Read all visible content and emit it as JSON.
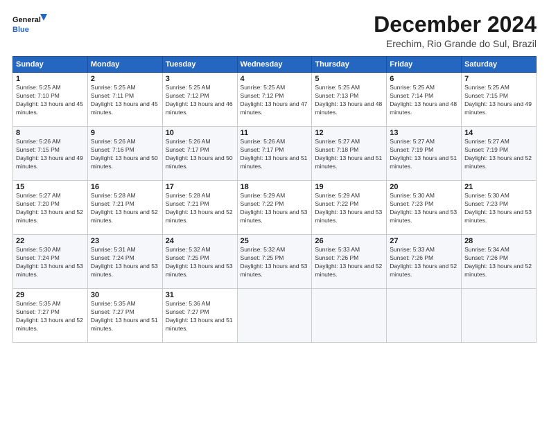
{
  "logo": {
    "line1": "General",
    "line2": "Blue"
  },
  "title": "December 2024",
  "subtitle": "Erechim, Rio Grande do Sul, Brazil",
  "weekdays": [
    "Sunday",
    "Monday",
    "Tuesday",
    "Wednesday",
    "Thursday",
    "Friday",
    "Saturday"
  ],
  "weeks": [
    [
      {
        "day": "1",
        "sunrise": "5:25 AM",
        "sunset": "7:10 PM",
        "daylight": "13 hours and 45 minutes."
      },
      {
        "day": "2",
        "sunrise": "5:25 AM",
        "sunset": "7:11 PM",
        "daylight": "13 hours and 45 minutes."
      },
      {
        "day": "3",
        "sunrise": "5:25 AM",
        "sunset": "7:12 PM",
        "daylight": "13 hours and 46 minutes."
      },
      {
        "day": "4",
        "sunrise": "5:25 AM",
        "sunset": "7:12 PM",
        "daylight": "13 hours and 47 minutes."
      },
      {
        "day": "5",
        "sunrise": "5:25 AM",
        "sunset": "7:13 PM",
        "daylight": "13 hours and 48 minutes."
      },
      {
        "day": "6",
        "sunrise": "5:25 AM",
        "sunset": "7:14 PM",
        "daylight": "13 hours and 48 minutes."
      },
      {
        "day": "7",
        "sunrise": "5:25 AM",
        "sunset": "7:15 PM",
        "daylight": "13 hours and 49 minutes."
      }
    ],
    [
      {
        "day": "8",
        "sunrise": "5:26 AM",
        "sunset": "7:15 PM",
        "daylight": "13 hours and 49 minutes."
      },
      {
        "day": "9",
        "sunrise": "5:26 AM",
        "sunset": "7:16 PM",
        "daylight": "13 hours and 50 minutes."
      },
      {
        "day": "10",
        "sunrise": "5:26 AM",
        "sunset": "7:17 PM",
        "daylight": "13 hours and 50 minutes."
      },
      {
        "day": "11",
        "sunrise": "5:26 AM",
        "sunset": "7:17 PM",
        "daylight": "13 hours and 51 minutes."
      },
      {
        "day": "12",
        "sunrise": "5:27 AM",
        "sunset": "7:18 PM",
        "daylight": "13 hours and 51 minutes."
      },
      {
        "day": "13",
        "sunrise": "5:27 AM",
        "sunset": "7:19 PM",
        "daylight": "13 hours and 51 minutes."
      },
      {
        "day": "14",
        "sunrise": "5:27 AM",
        "sunset": "7:19 PM",
        "daylight": "13 hours and 52 minutes."
      }
    ],
    [
      {
        "day": "15",
        "sunrise": "5:27 AM",
        "sunset": "7:20 PM",
        "daylight": "13 hours and 52 minutes."
      },
      {
        "day": "16",
        "sunrise": "5:28 AM",
        "sunset": "7:21 PM",
        "daylight": "13 hours and 52 minutes."
      },
      {
        "day": "17",
        "sunrise": "5:28 AM",
        "sunset": "7:21 PM",
        "daylight": "13 hours and 52 minutes."
      },
      {
        "day": "18",
        "sunrise": "5:29 AM",
        "sunset": "7:22 PM",
        "daylight": "13 hours and 53 minutes."
      },
      {
        "day": "19",
        "sunrise": "5:29 AM",
        "sunset": "7:22 PM",
        "daylight": "13 hours and 53 minutes."
      },
      {
        "day": "20",
        "sunrise": "5:30 AM",
        "sunset": "7:23 PM",
        "daylight": "13 hours and 53 minutes."
      },
      {
        "day": "21",
        "sunrise": "5:30 AM",
        "sunset": "7:23 PM",
        "daylight": "13 hours and 53 minutes."
      }
    ],
    [
      {
        "day": "22",
        "sunrise": "5:30 AM",
        "sunset": "7:24 PM",
        "daylight": "13 hours and 53 minutes."
      },
      {
        "day": "23",
        "sunrise": "5:31 AM",
        "sunset": "7:24 PM",
        "daylight": "13 hours and 53 minutes."
      },
      {
        "day": "24",
        "sunrise": "5:32 AM",
        "sunset": "7:25 PM",
        "daylight": "13 hours and 53 minutes."
      },
      {
        "day": "25",
        "sunrise": "5:32 AM",
        "sunset": "7:25 PM",
        "daylight": "13 hours and 53 minutes."
      },
      {
        "day": "26",
        "sunrise": "5:33 AM",
        "sunset": "7:26 PM",
        "daylight": "13 hours and 52 minutes."
      },
      {
        "day": "27",
        "sunrise": "5:33 AM",
        "sunset": "7:26 PM",
        "daylight": "13 hours and 52 minutes."
      },
      {
        "day": "28",
        "sunrise": "5:34 AM",
        "sunset": "7:26 PM",
        "daylight": "13 hours and 52 minutes."
      }
    ],
    [
      {
        "day": "29",
        "sunrise": "5:35 AM",
        "sunset": "7:27 PM",
        "daylight": "13 hours and 52 minutes."
      },
      {
        "day": "30",
        "sunrise": "5:35 AM",
        "sunset": "7:27 PM",
        "daylight": "13 hours and 51 minutes."
      },
      {
        "day": "31",
        "sunrise": "5:36 AM",
        "sunset": "7:27 PM",
        "daylight": "13 hours and 51 minutes."
      },
      null,
      null,
      null,
      null
    ]
  ]
}
